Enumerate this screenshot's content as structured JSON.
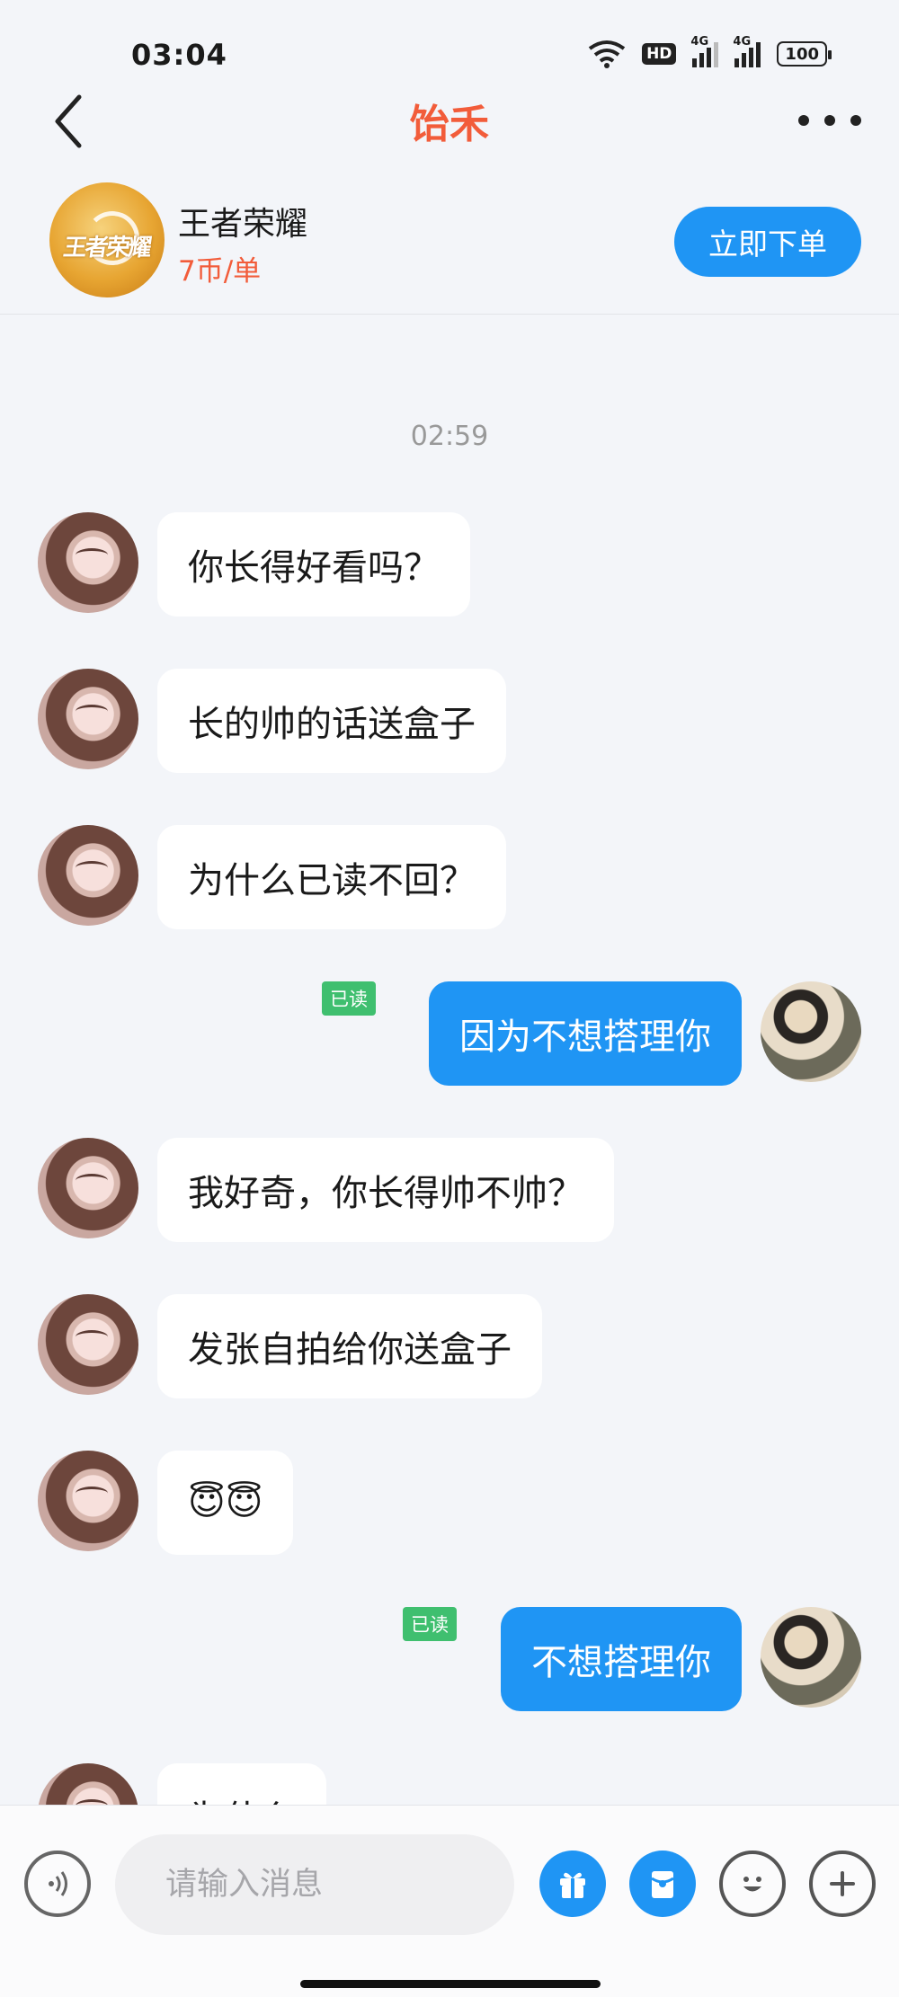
{
  "status_bar": {
    "time": "03:04",
    "hd": "HD",
    "net1": "4G",
    "net2": "4G",
    "battery": "100"
  },
  "nav": {
    "title": "饴禾"
  },
  "product": {
    "game_icon_text": "王者荣耀",
    "name": "王者荣耀",
    "price": "7币/单",
    "order_button": "立即下单"
  },
  "chat": {
    "timestamp": "02:59",
    "read_label": "已读",
    "messages": [
      {
        "side": "in",
        "text": "你长得好看吗？"
      },
      {
        "side": "in",
        "text": "长的帅的话送盒子"
      },
      {
        "side": "in",
        "text": "为什么已读不回？"
      },
      {
        "side": "out",
        "text": "因为不想搭理你",
        "status": "已读"
      },
      {
        "side": "in",
        "text": "我好奇，你长得帅不帅？"
      },
      {
        "side": "in",
        "text": "发张自拍给你送盒子"
      },
      {
        "side": "in",
        "text": "😇😇"
      },
      {
        "side": "out",
        "text": "不想搭理你",
        "status": "已读"
      },
      {
        "side": "in",
        "text": "为什么"
      }
    ]
  },
  "input": {
    "placeholder": "请输入消息"
  },
  "icons": {
    "back": "chevron-left-icon",
    "more": "more-dots-icon",
    "voice": "voice-icon",
    "gift": "gift-icon",
    "red_packet": "red-packet-icon",
    "emoji": "emoji-icon",
    "plus": "plus-icon"
  },
  "colors": {
    "accent": "#1f95f4",
    "title": "#f25c3a",
    "read_badge": "#3fbf6f",
    "background": "#f3f5f9"
  }
}
